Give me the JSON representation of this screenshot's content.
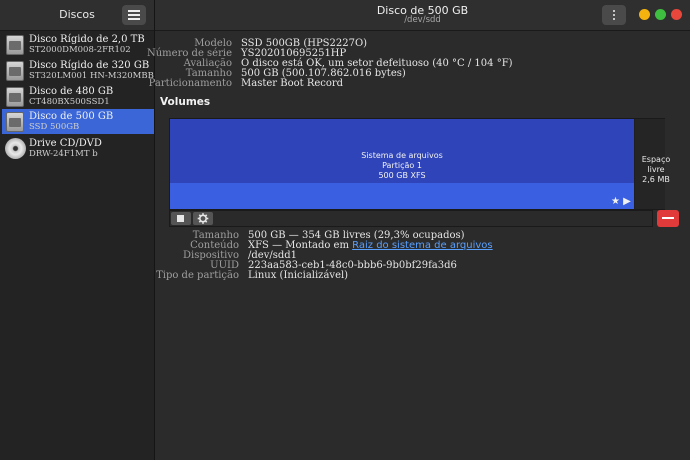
{
  "sidebar": {
    "title": "Discos",
    "items": [
      {
        "name": "Disco Rígido de 2,0 TB",
        "sub": "ST2000DM008-2FR102",
        "icon": "hard-disk-icon"
      },
      {
        "name": "Disco Rígido de 320 GB",
        "sub": "ST320LM001 HN-M320MBB",
        "icon": "hard-disk-icon"
      },
      {
        "name": "Disco de 480 GB",
        "sub": "CT480BX500SSD1",
        "icon": "hard-disk-icon"
      },
      {
        "name": "Disco de 500 GB",
        "sub": "SSD 500GB",
        "icon": "hard-disk-icon",
        "selected": true
      },
      {
        "name": "Drive CD/DVD",
        "sub": "DRW-24F1MT   b",
        "icon": "optical-disc-icon"
      }
    ]
  },
  "header": {
    "title": "Disco de 500 GB",
    "subtitle": "/dev/sdd"
  },
  "window_buttons": {
    "minimize_color": "#f5b30f",
    "maximize_color": "#3fbf3f",
    "close_color": "#e9473c"
  },
  "disk_info": [
    {
      "label": "Modelo",
      "value": "SSD 500GB (HPS2227O)"
    },
    {
      "label": "Número de série",
      "value": "YS202010695251HP"
    },
    {
      "label": "Avaliação",
      "value": "O disco está OK, um setor defeituoso (40 °C / 104 °F)"
    },
    {
      "label": "Tamanho",
      "value": "500 GB (500.107.862.016 bytes)"
    },
    {
      "label": "Particionamento",
      "value": "Master Boot Record"
    }
  ],
  "volumes": {
    "title": "Volumes",
    "partition": {
      "line1": "Sistema de arquivos",
      "line2": "Partição 1",
      "line3": "500 GB XFS",
      "color": "#2e44b8",
      "marks": "★ ▶"
    },
    "free_space": {
      "line1": "Espaço livre",
      "line2": "2,6 MB"
    }
  },
  "volume_info": {
    "size_label": "Tamanho",
    "size_value": "500 GB — 354 GB livres (29,3% ocupados)",
    "content_label": "Conteúdo",
    "content_prefix": "XFS — Montado em ",
    "content_link": "Raiz do sistema de arquivos",
    "device_label": "Dispositivo",
    "device_value": "/dev/sdd1",
    "uuid_label": "UUID",
    "uuid_value": "223aa583-ceb1-48c0-bbb6-9b0bf29fa3d6",
    "ptype_label": "Tipo de partição",
    "ptype_value": "Linux (Inicializável)"
  }
}
